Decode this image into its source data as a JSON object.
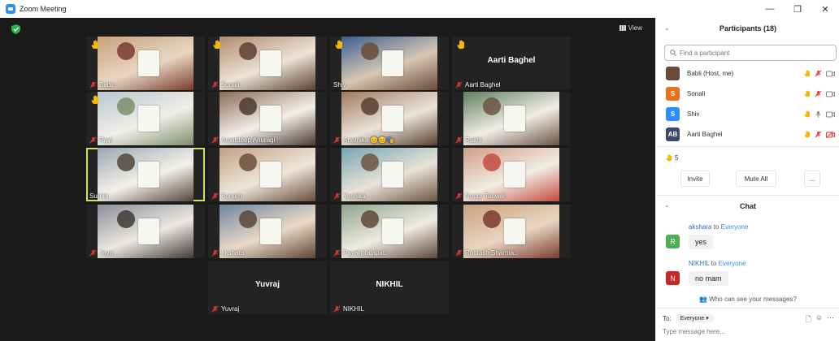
{
  "window": {
    "title": "Zoom Meeting",
    "minimize": "—",
    "maximize": "❐",
    "close": "✕"
  },
  "toolbar": {
    "view_label": "View"
  },
  "gallery": {
    "tiles": [
      {
        "name": "Babli",
        "hand": true,
        "photo": true,
        "muted": true
      },
      {
        "name": "Sonali",
        "hand": true,
        "photo": true,
        "muted": true
      },
      {
        "name": "Shiv",
        "hand": true,
        "photo": true,
        "muted": false
      },
      {
        "name": "Aarti Baghel",
        "hand": true,
        "photo": false,
        "big_name": "Aarti Baghel",
        "muted": true
      },
      {
        "name": "Ravi",
        "hand": true,
        "photo": true,
        "muted": true
      },
      {
        "name": "Amardeep Anuragi",
        "hand": false,
        "photo": true,
        "muted": true
      },
      {
        "name": "Anamika 😊😊🎭",
        "hand": false,
        "photo": true,
        "muted": true
      },
      {
        "name": "Rakhi",
        "hand": false,
        "photo": true,
        "muted": true
      },
      {
        "name": "Surbhi",
        "hand": false,
        "photo": true,
        "muted": false,
        "active": true
      },
      {
        "name": "Sonam",
        "hand": false,
        "photo": true,
        "muted": true
      },
      {
        "name": "Yashika",
        "hand": false,
        "photo": true,
        "muted": true
      },
      {
        "name": "Nupur Tanwar",
        "hand": false,
        "photo": true,
        "muted": true
      },
      {
        "name": "Jaya",
        "hand": false,
        "photo": true,
        "muted": true
      },
      {
        "name": "akshara",
        "hand": false,
        "photo": true,
        "muted": true
      },
      {
        "name": "Payal prajapati",
        "hand": false,
        "photo": true,
        "muted": true
      },
      {
        "name": "Rohtash Sharma..",
        "hand": false,
        "photo": true,
        "muted": true
      },
      {
        "name": "Yuvraj",
        "hand": false,
        "photo": false,
        "big_name": "Yuvraj",
        "muted": true
      },
      {
        "name": "NIKHIL",
        "hand": false,
        "photo": false,
        "big_name": "NIKHIL",
        "muted": true
      }
    ]
  },
  "participants": {
    "title": "Participants (18)",
    "search_placeholder": "Find a participant",
    "list": [
      {
        "initials": "",
        "name": "Babli (Host, me)",
        "color": "#6b4a3a",
        "mic": "muted",
        "cam": "off"
      },
      {
        "initials": "S",
        "name": "Sonali",
        "color": "#e8701c",
        "mic": "muted",
        "cam": "off"
      },
      {
        "initials": "S",
        "name": "Shiv",
        "color": "#2d8cff",
        "mic": "on",
        "cam": "off"
      },
      {
        "initials": "AB",
        "name": "Aarti Baghel",
        "color": "#3a4a6b",
        "mic": "muted",
        "cam": "red"
      }
    ],
    "raised_count": "5",
    "invite_label": "Invite",
    "mute_all_label": "Mute All",
    "more_label": "..."
  },
  "chat": {
    "title": "Chat",
    "messages": [
      {
        "from": "akshara",
        "to_word": "to",
        "target": "Everyone",
        "initial": "R",
        "color": "#4caf50",
        "text": "yes"
      },
      {
        "from": "NIKHIL",
        "to_word": "to",
        "target": "Everyone",
        "initial": "N",
        "color": "#c62828",
        "text": "no mam"
      }
    ],
    "who_can_see": "Who can see your messages?",
    "to_label": "To:",
    "to_value": "Everyone ▾",
    "input_placeholder": "Type message here..."
  },
  "colors": {
    "accent": "#2d8cff",
    "active_speaker": "#c8e85a",
    "hand": "#f5b700",
    "muted": "#e53935"
  }
}
